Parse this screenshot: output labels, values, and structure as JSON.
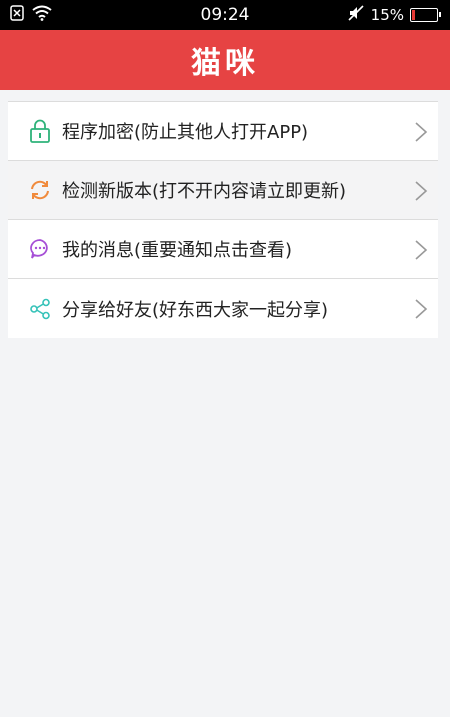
{
  "status_bar": {
    "time": "09:24",
    "battery_percent_text": "15%",
    "battery_level": 0.15,
    "icons": [
      "sim-off-icon",
      "wifi-icon",
      "mute-icon",
      "battery-icon"
    ]
  },
  "header": {
    "title": "猫咪",
    "color": "#e64343"
  },
  "menu": {
    "items": [
      {
        "label": "程序加密(防止其他人打开APP)",
        "icon": "lock-icon",
        "icon_color": "#2fb37a"
      },
      {
        "label": "检测新版本(打不开内容请立即更新)",
        "icon": "refresh-icon",
        "icon_color": "#f08a3c"
      },
      {
        "label": "我的消息(重要通知点击查看)",
        "icon": "message-icon",
        "icon_color": "#a64fd6"
      },
      {
        "label": "分享给好友(好东西大家一起分享)",
        "icon": "share-icon",
        "icon_color": "#35c2b8"
      }
    ]
  }
}
